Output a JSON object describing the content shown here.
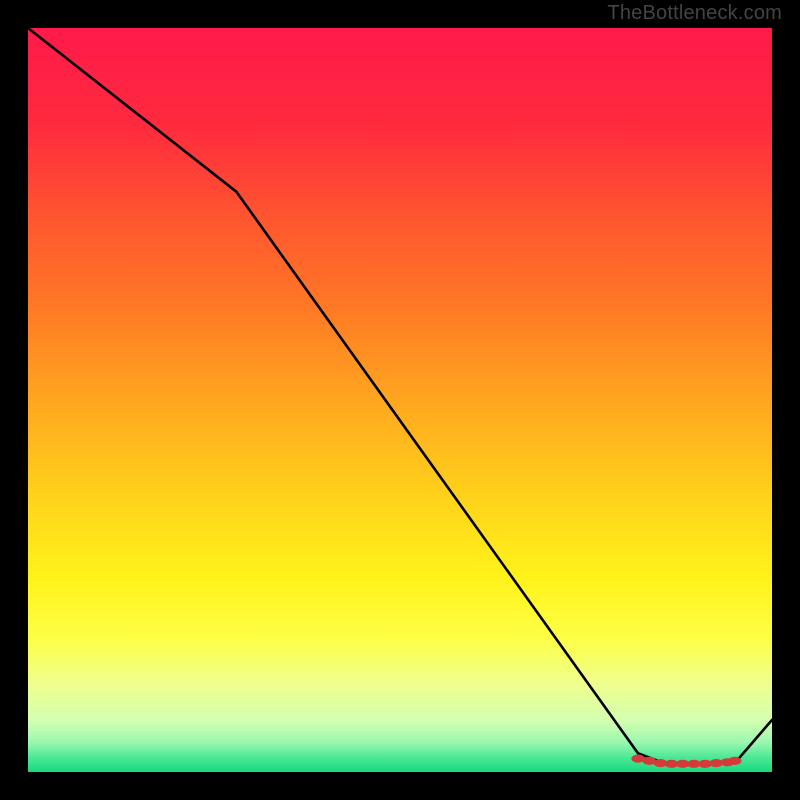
{
  "attribution": "TheBottleneck.com",
  "chart_data": {
    "type": "line",
    "title": "",
    "xlabel": "",
    "ylabel": "",
    "xlim": [
      0,
      100
    ],
    "ylim": [
      0,
      100
    ],
    "x": [
      0,
      28,
      82,
      86,
      90,
      95,
      100
    ],
    "values": [
      100,
      78,
      2.5,
      1,
      1,
      1.2,
      7
    ],
    "markers_x": [
      82,
      83.5,
      85,
      86.5,
      88,
      89.5,
      91,
      92.5,
      94,
      95
    ],
    "markers_y": [
      1.8,
      1.5,
      1.2,
      1.1,
      1.1,
      1.1,
      1.1,
      1.2,
      1.3,
      1.5
    ],
    "gradient_stops": [
      {
        "offset": 0,
        "color": "#ff1a4a"
      },
      {
        "offset": 13,
        "color": "#ff2a3e"
      },
      {
        "offset": 25,
        "color": "#ff5430"
      },
      {
        "offset": 38,
        "color": "#ff7a25"
      },
      {
        "offset": 50,
        "color": "#ffa61f"
      },
      {
        "offset": 63,
        "color": "#ffd21a"
      },
      {
        "offset": 74,
        "color": "#fff31a"
      },
      {
        "offset": 82,
        "color": "#fdff46"
      },
      {
        "offset": 88,
        "color": "#f0ff8c"
      },
      {
        "offset": 93,
        "color": "#d4ffb0"
      },
      {
        "offset": 96,
        "color": "#9cf7b0"
      },
      {
        "offset": 98,
        "color": "#4de896"
      },
      {
        "offset": 100,
        "color": "#17d97e"
      }
    ]
  }
}
